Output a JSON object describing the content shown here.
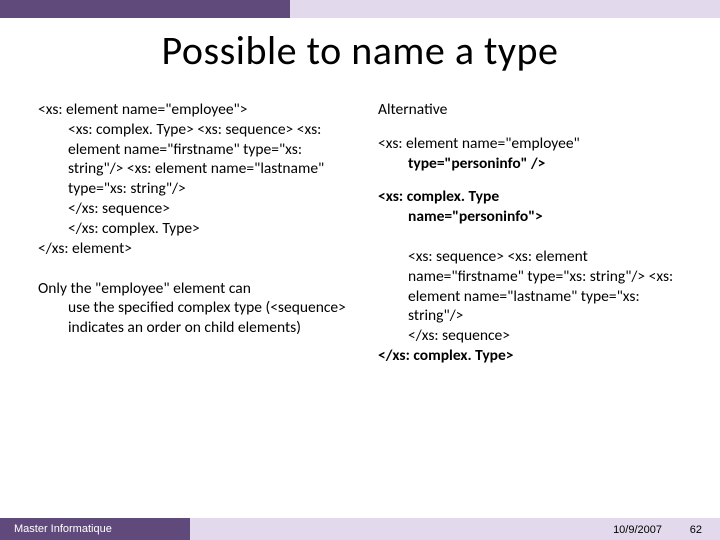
{
  "title": "Possible to name a type",
  "left": {
    "l1": "<xs: element name=\"employee\">",
    "l2": "<xs: complex. Type> <xs: sequence> <xs: element name=\"firstname\" type=\"xs: string\"/> <xs: element name=\"lastname\" type=\"xs: string\"/>",
    "l3": "</xs: sequence>",
    "l4": "</xs: complex. Type>",
    "l5": "</xs: element>",
    "note": "Only the \"employee\" element can use the specified complex type (<sequence> indicates an order on child elements)"
  },
  "right": {
    "r1": "Alternative",
    "r2a": "<xs: element name=\"employee\" ",
    "r2b": "type=\"personinfo\" />",
    "r3a": "<xs: complex. Type ",
    "r3b": "name=\"personinfo\">",
    "r4": "<xs: sequence> <xs: element name=\"firstname\" type=\"xs: string\"/> <xs: element name=\"lastname\" type=\"xs: string\"/>",
    "r5": "</xs: sequence>",
    "r6": "</xs: complex. Type>"
  },
  "footer": {
    "label": "Master Informatique",
    "date": "10/9/2007",
    "num": "62"
  }
}
